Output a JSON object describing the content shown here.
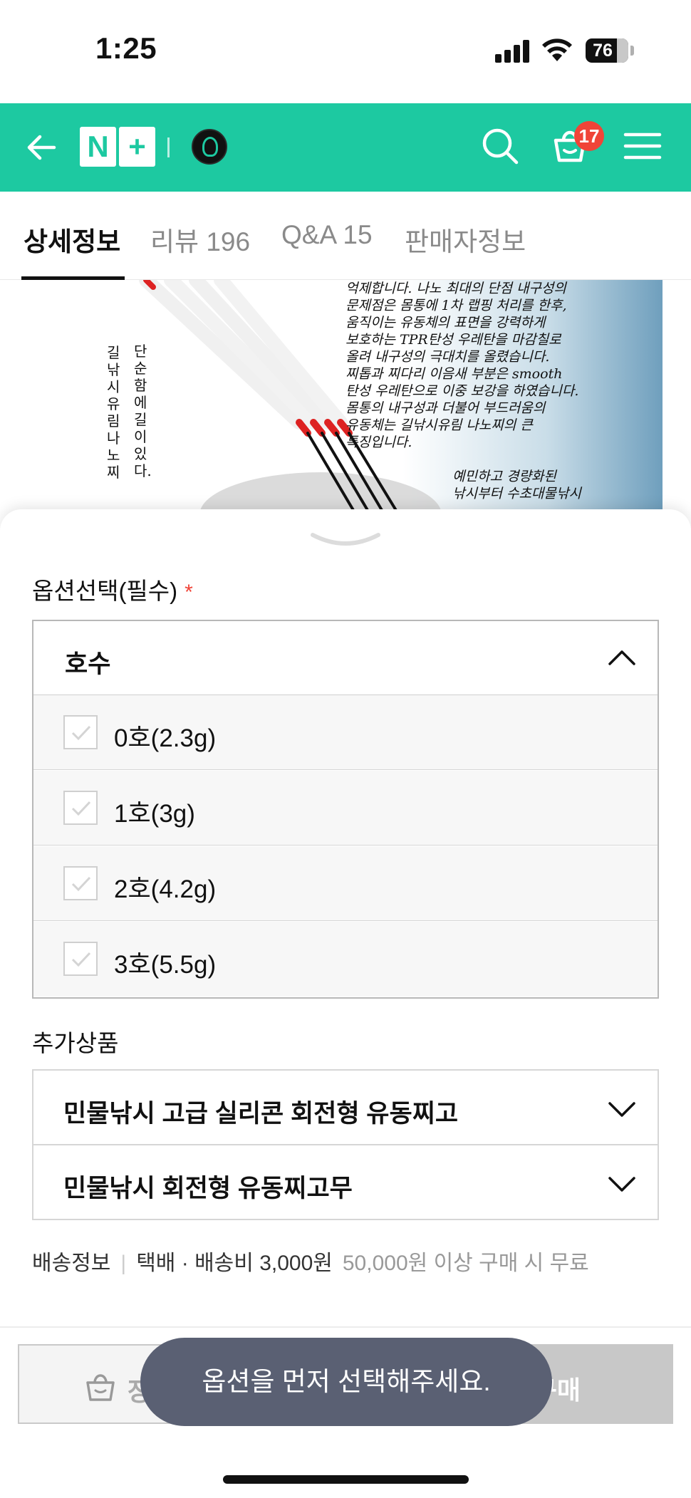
{
  "status": {
    "time": "1:25",
    "battery": "76"
  },
  "header": {
    "logo_left": "N",
    "logo_right": "+",
    "cart_count": "17"
  },
  "tabs": [
    {
      "label": "상세정보",
      "active": true
    },
    {
      "label": "리뷰 196",
      "active": false
    },
    {
      "label": "Q&A 15",
      "active": false
    },
    {
      "label": "판매자정보",
      "active": false
    }
  ],
  "product_image": {
    "text_block": "억제합니다. 나노 최대의 단점 내구성의\n문제점은 몸통에 1차 랩핑 처리를 한후,\n움직이는 유동체의 표면을 강력하게\n보호하는 TPR탄성 우레탄을 마감칠로\n올려 내구성의 극대치를 올렸습니다.\n찌톱과 찌다리 이음새 부분은 smooth\n탄성 우레탄으로 이중 보강을 하였습니다.\n몸통의 내구성과 더불어 부드러움의\n유동체는 길낚시유림 나노찌의 큰\n특징입니다.",
    "text_block_2": "예민하고 경량화된\n낚시부터 수초대물낚시",
    "vertical_left": "길낚시유림 나노찌",
    "vertical_right": "단순함에 길이있다."
  },
  "options": {
    "section_label": "옵션선택(필수)",
    "required_mark": "*",
    "dropdown_label": "호수",
    "items": [
      {
        "label": "0호(2.3g)"
      },
      {
        "label": "1호(3g)"
      },
      {
        "label": "2호(4.2g)"
      },
      {
        "label": "3호(5.5g)"
      }
    ]
  },
  "addons": {
    "section_label": "추가상품",
    "items": [
      {
        "label": "민물낚시 고급 실리콘 회전형 유동찌고"
      },
      {
        "label": "민물낚시 회전형 유동찌고무"
      }
    ]
  },
  "shipping": {
    "label": "배송정보",
    "method": "택배 · 배송비 3,000원",
    "note": "50,000원 이상 구매 시 무료"
  },
  "actions": {
    "cart_label": "장",
    "buy_label": "구매"
  },
  "toast": {
    "message": "옵션을 먼저 선택해주세요."
  },
  "colors": {
    "brand": "#1dc9a1",
    "badge": "#f04438",
    "toast_bg": "#5a6073"
  }
}
